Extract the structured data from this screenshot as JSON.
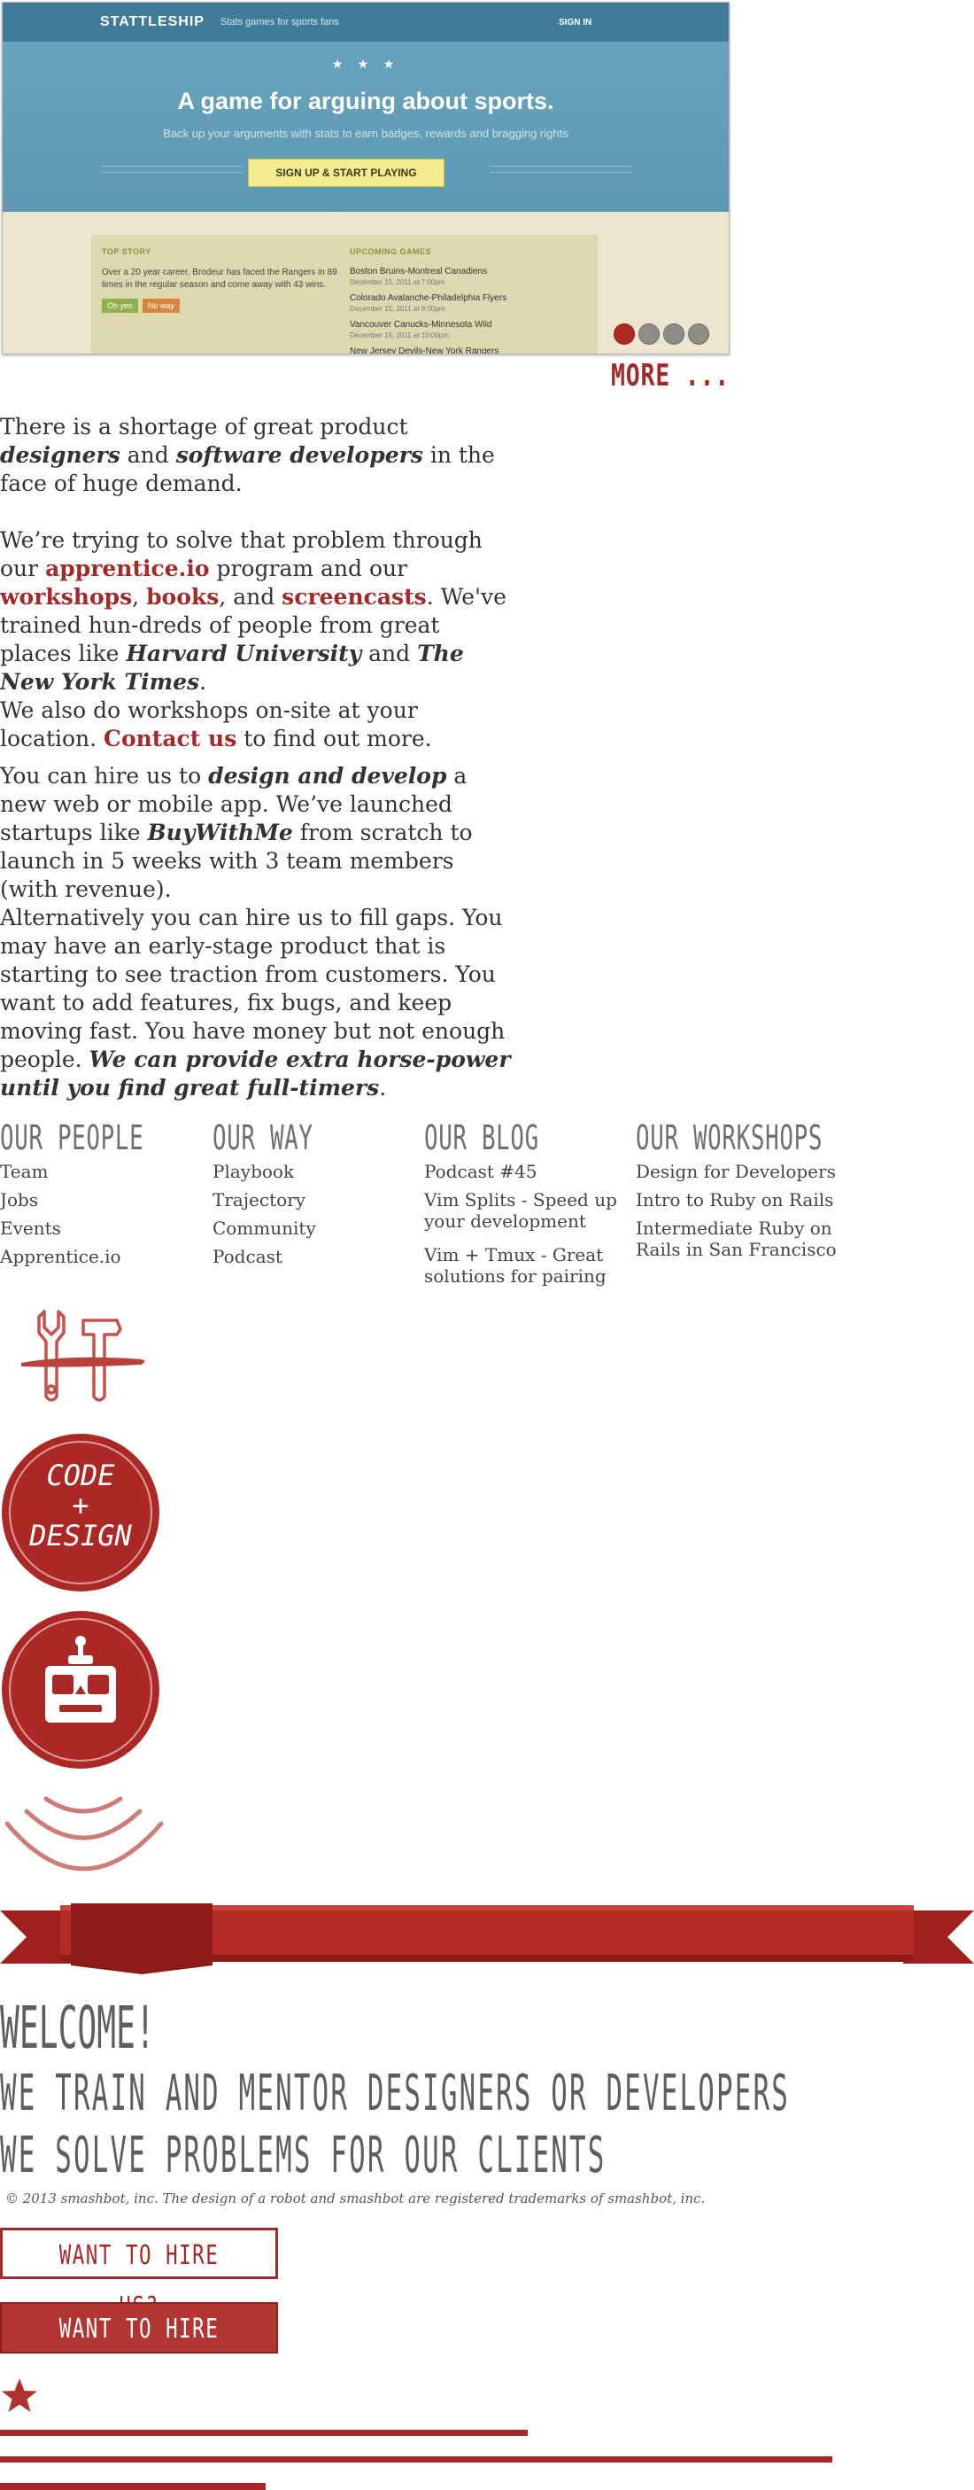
{
  "hero": {
    "brand": "STATTLESHIP",
    "tagline": "Stats games for sports fans",
    "signin": "SIGN IN",
    "stars": "★ ★ ★",
    "headline": "A game for arguing about sports.",
    "subhead": "Back up your arguments with stats to earn badges, rewards and bragging rights",
    "cta": "SIGN UP & START PLAYING",
    "top_story": {
      "heading": "TOP STORY",
      "text": "Over a 20 year career, Brodeur has faced the Rangers in 89 times in the regular season and come away with 43 wins.",
      "yes": "Oh yes",
      "no": "No way"
    },
    "upcoming": {
      "heading": "UPCOMING GAMES",
      "games": [
        {
          "teams": "Boston Bruins-Montreal Canadiens",
          "date": "December 15, 2011 at 7:00pm"
        },
        {
          "teams": "Colorado Avalanche-Philadelphia Flyers",
          "date": "December 15, 2011 at 8:00pm"
        },
        {
          "teams": "Vancouver Canucks-Minnesota Wild",
          "date": "December 15, 2011 at 10:00pm"
        },
        {
          "teams": "New Jersey Devils-New York Rangers",
          "date": ""
        }
      ]
    },
    "active_slide": 1,
    "slide_count": 4
  },
  "more_link": "MORE ...",
  "intro": {
    "p1_a": "There is a shortage of great product ",
    "p1_em1": "designers",
    "p1_b": " and ",
    "p1_em2": "software developers",
    "p1_c": " in the face of huge demand.",
    "p2_a": "We’re trying to solve that problem through our ",
    "p2_link1": "apprentice.io",
    "p2_b": " program and our ",
    "p2_link2": "workshops",
    "p2_c": ", ",
    "p2_link3": "books",
    "p2_d": ", and ",
    "p2_link4": "screencasts",
    "p2_e": ". We've trained hun-dreds of people from great places like ",
    "p2_em1": "Harvard University",
    "p2_f": " and ",
    "p2_em2": "The New York Times",
    "p2_g": ".",
    "p3_a": "We also do workshops on-site at your location. ",
    "p3_link": "Contact us",
    "p3_b": " to find out more.",
    "p4_a": "You can hire us to ",
    "p4_em1": "design and develop",
    "p4_b": " a new web or mobile app. We’ve launched startups like ",
    "p4_em2": "BuyWithMe",
    "p4_c": " from scratch to launch in 5 weeks with 3 team members (with revenue).",
    "p5_a": "Alternatively you can hire us to fill gaps. You may have an early-stage product that is starting to see traction from customers. You want to add features, fix bugs, and keep moving fast. You have money but not enough people. ",
    "p5_em": "We can provide extra horse-power until you find great full-timers",
    "p5_b": "."
  },
  "footer_columns": [
    {
      "heading": "OUR PEOPLE",
      "items": [
        "Team",
        "Jobs",
        "Events",
        "Apprentice.io"
      ]
    },
    {
      "heading": "OUR WAY",
      "items": [
        "Playbook",
        "Trajectory",
        "Community",
        "Podcast"
      ]
    },
    {
      "heading": "OUR BLOG",
      "items": [
        "Podcast #45",
        "Vim Splits - Speed up your development",
        "Vim + Tmux -  Great solutions for pairing"
      ]
    },
    {
      "heading": "OUR WORKSHOPS",
      "items": [
        "Design for Developers",
        "Intro to Ruby on Rails",
        "Intermediate Ruby on Rails in  San Francisco"
      ]
    }
  ],
  "badge_code_design": "CODE\n+\nDESIGN",
  "welcome": "WELCOME!",
  "line_train": "WE TRAIN AND MENTOR DESIGNERS OR DEVELOPERS",
  "line_solve": "WE SOLVE PROBLEMS FOR OUR CLIENTS",
  "copyright": "© 2013 smashbot, inc. The design of a robot and smashbot are registered trademarks of smashbot, inc.",
  "hire_outline": "WANT TO HIRE US?",
  "hire_filled": "WANT TO HIRE US?",
  "colors": {
    "brand_red": "#a32a28",
    "badge_red": "#ac2824",
    "heading_gray": "#6f6f6f",
    "hero_blue": "#6aa6c0",
    "cta_yellow": "#f4ec8e"
  },
  "icons": [
    "wrench-hammer-brush-icon",
    "robot-icon",
    "signal-waves-icon",
    "star-icon",
    "ribbon-banner"
  ]
}
